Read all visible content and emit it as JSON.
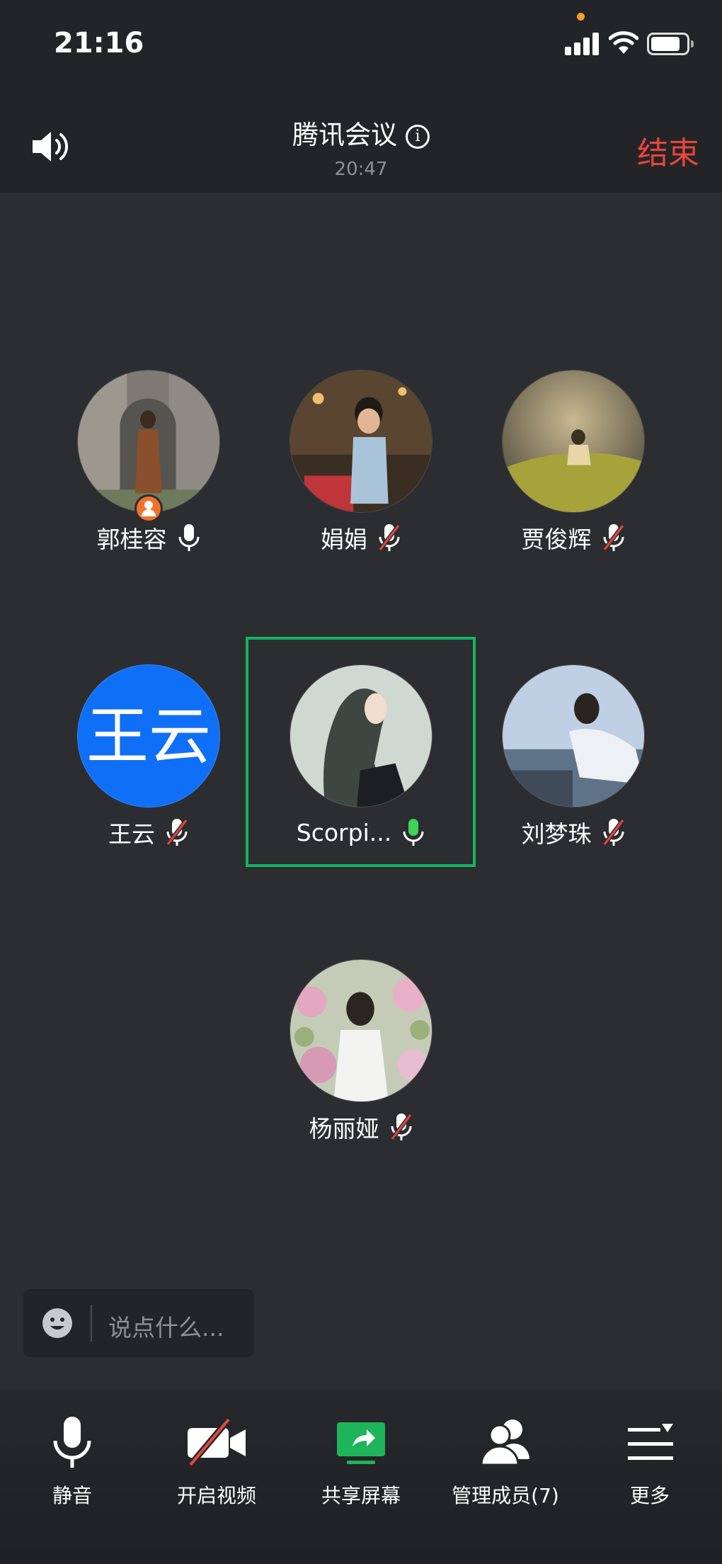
{
  "status_bar": {
    "time": "21:16"
  },
  "header": {
    "title": "腾讯会议",
    "meeting_time": "20:47",
    "end_label": "结束"
  },
  "participants": [
    {
      "name": "郭桂容",
      "mic": "on-white",
      "avatar": "photo",
      "host": true
    },
    {
      "name": "娟娟",
      "mic": "muted",
      "avatar": "photo"
    },
    {
      "name": "贾俊辉",
      "mic": "muted",
      "avatar": "photo"
    },
    {
      "name": "王云",
      "mic": "muted",
      "avatar": "text",
      "avatar_text": "王云"
    },
    {
      "name": "Scorpi...",
      "mic": "speaking",
      "avatar": "photo",
      "selected": true
    },
    {
      "name": "刘梦珠",
      "mic": "muted",
      "avatar": "photo"
    },
    {
      "name": "杨丽娅",
      "mic": "muted",
      "avatar": "photo"
    }
  ],
  "chat": {
    "placeholder": "说点什么..."
  },
  "toolbar": {
    "mute_label": "静音",
    "video_label": "开启视频",
    "share_label": "共享屏幕",
    "members_label": "管理成员(7)",
    "more_label": "更多"
  },
  "colors": {
    "background": "#2b2d31",
    "end_red": "#e8453c",
    "accent_green": "#13b55f",
    "avatar_blue": "#0f6ff7",
    "muted_red": "#e8453c"
  }
}
